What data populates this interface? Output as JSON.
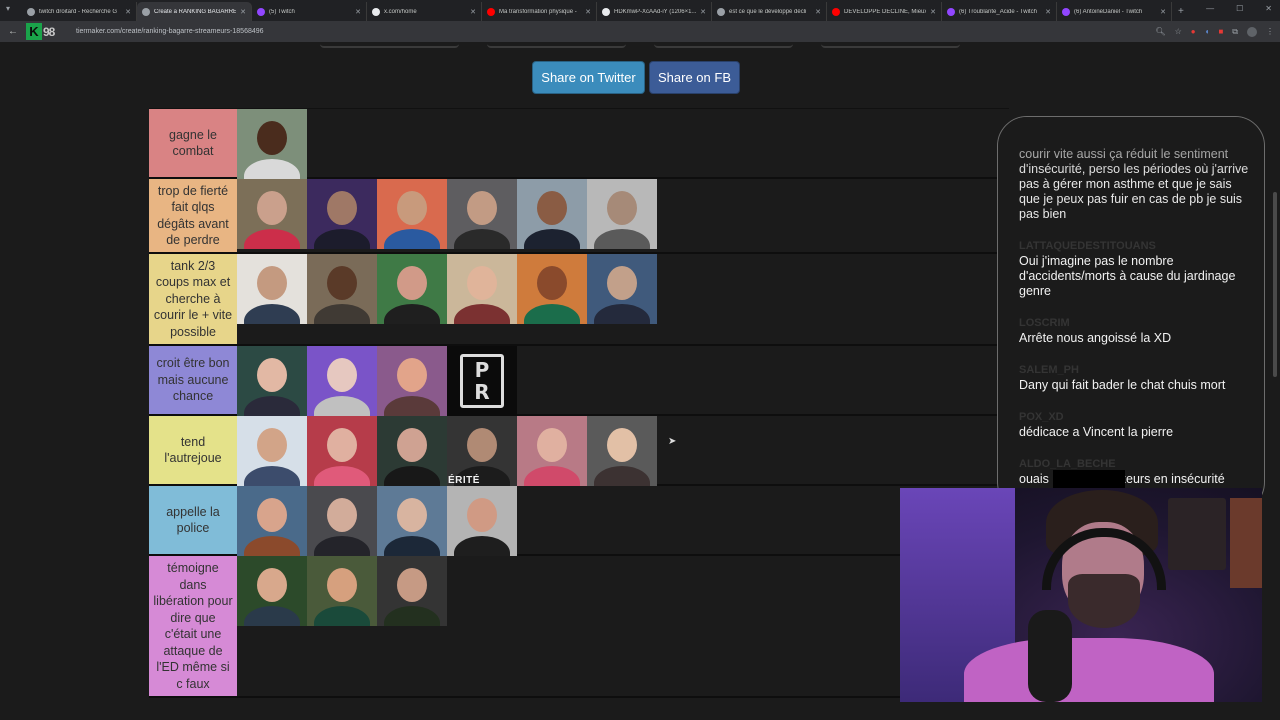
{
  "browser": {
    "tabs": [
      {
        "title": "twitch droitard - Recherche G",
        "color": "#9aa0a6",
        "active": false
      },
      {
        "title": "Create a RANKING BAGARRE",
        "color": "#9aa0a6",
        "active": true
      },
      {
        "title": "(5) Twitch",
        "color": "#9146ff",
        "active": false
      },
      {
        "title": "x.com/home",
        "color": "#e8eaed",
        "active": false
      },
      {
        "title": "Ma transformation physique -",
        "color": "#ff0000",
        "active": false
      },
      {
        "title": "HDKmwP-XcAAd-iY (1206×1...",
        "color": "#e8eaed",
        "active": false
      },
      {
        "title": "est ce que le développé décli",
        "color": "#9aa0a6",
        "active": false
      },
      {
        "title": "DÉVELOPPÉ DÉCLINÉ, Mieux...",
        "color": "#ff0000",
        "active": false
      },
      {
        "title": "(6) Troublante_Acide - Twitch",
        "color": "#9146ff",
        "active": false
      },
      {
        "title": "(6) AntoineDaniel - Twitch",
        "color": "#9146ff",
        "active": false
      }
    ],
    "new_tab_label": "+",
    "url": "tiermaker.com/create/ranking-bagarre-streameurs-18568496"
  },
  "share": {
    "twitter_label": "Share on Twitter",
    "fb_label": "Share on FB"
  },
  "tiers": [
    {
      "label": "gagne le combat",
      "color": "#d98384",
      "height": 70,
      "items": [
        {
          "bg": "#7d8f7a",
          "skin": "#4a2c1d",
          "cloth": "#d9d9d9"
        }
      ]
    },
    {
      "label": "trop de fierté fait qlqs dégâts avant de perdre",
      "color": "#e8b583",
      "height": 75,
      "items": [
        {
          "bg": "#7c6f58",
          "skin": "#caa08c",
          "cloth": "#cc2e4a"
        },
        {
          "bg": "#3c2a5e",
          "skin": "#9f7866",
          "cloth": "#1c1c2c"
        },
        {
          "bg": "#d96a4e",
          "skin": "#c89a7c",
          "cloth": "#2a5aa0"
        },
        {
          "bg": "#5e5d60",
          "skin": "#c29b84",
          "cloth": "#2a2a2a"
        },
        {
          "bg": "#8d9ca8",
          "skin": "#8a5c44",
          "cloth": "#1c2230"
        },
        {
          "bg": "#b8b8b8",
          "skin": "#a68a78",
          "cloth": "#5a5a5a"
        }
      ]
    },
    {
      "label": "tank 2/3 coups max et cherche à courir le + vite possible",
      "color": "#e7d58a",
      "height": 92,
      "items": [
        {
          "bg": "#e4e1dc",
          "skin": "#c49a80",
          "cloth": "#2f3d52"
        },
        {
          "bg": "#7a6b58",
          "skin": "#5a3a28",
          "cloth": "#403a34"
        },
        {
          "bg": "#3f7a46",
          "skin": "#d19a88",
          "cloth": "#1f1f1f"
        },
        {
          "bg": "#cbb79a",
          "skin": "#e0b49a",
          "cloth": "#7b3131"
        },
        {
          "bg": "#cf7b3c",
          "skin": "#8a4a2c",
          "cloth": "#1b6d4b"
        },
        {
          "bg": "#405a7c",
          "skin": "#c2a08a",
          "cloth": "#242a3c"
        }
      ]
    },
    {
      "label": "croit être bon mais aucune chance",
      "color": "#8e88d6",
      "height": 70,
      "items": [
        {
          "bg": "#2c4a44",
          "skin": "#e2b8a4",
          "cloth": "#2a2a3a"
        },
        {
          "bg": "#7a54c8",
          "skin": "#e6c8c0",
          "cloth": "#c0c0c0"
        },
        {
          "bg": "#8a5a8c",
          "skin": "#e2a48a",
          "cloth": "#5a3a3a"
        },
        {
          "pr": true
        }
      ]
    },
    {
      "label": "tend l'autrejoue",
      "color": "#e4e28a",
      "height": 70,
      "items": [
        {
          "bg": "#d6dfe8",
          "skin": "#d2a488",
          "cloth": "#3c4c6c"
        },
        {
          "bg": "#b63c4a",
          "skin": "#e0b0a0",
          "cloth": "#e05a7a"
        },
        {
          "bg": "#2c3a34",
          "skin": "#cfa292",
          "cloth": "#181818"
        },
        {
          "bg": "#343434",
          "skin": "#b08a74",
          "cloth": "#1c1c1c",
          "erite": "ÉRITÉ"
        },
        {
          "bg": "#b87a86",
          "skin": "#e0b0a0",
          "cloth": "#d04a6a"
        },
        {
          "bg": "#5a5a5a",
          "skin": "#e2c0a6",
          "cloth": "#3c3232"
        }
      ]
    },
    {
      "label": "appelle la police",
      "color": "#80bcd8",
      "height": 70,
      "items": [
        {
          "bg": "#4a6a8a",
          "skin": "#d8a48c",
          "cloth": "#8b4a2c"
        },
        {
          "bg": "#4a4a4e",
          "skin": "#d2ac9a",
          "cloth": "#24242a"
        },
        {
          "bg": "#5e7a96",
          "skin": "#d8b4a0",
          "cloth": "#1c2838"
        },
        {
          "bg": "#b4b4b4",
          "skin": "#d09a84",
          "cloth": "#1e1e1e"
        }
      ]
    },
    {
      "label": "témoigne dans libération pour dire que c'était une attaque de l'ED même si c faux",
      "color": "#d68ad6",
      "height": 142,
      "items": [
        {
          "bg": "#2c4a2a",
          "skin": "#d8a88c",
          "cloth": "#2a3a4a"
        },
        {
          "bg": "#4a5a3a",
          "skin": "#d6a07e",
          "cloth": "#1a4a3a"
        },
        {
          "bg": "#343434",
          "skin": "#c69a84",
          "cloth": "#23301f"
        }
      ]
    }
  ],
  "chat": {
    "messages": [
      {
        "user": "",
        "text": "courir vite aussi ça réduit le sentiment d'insécurité, perso les périodes où j'arrive pas à gérer mon asthme et que je sais que je peux pas fuir en cas de pb je suis pas bien"
      },
      {
        "user": "LATTAQUEDESTITOUANS",
        "text": "Oui j'imagine pas le nombre d'accidents/morts à cause du jardinage genre"
      },
      {
        "user": "LOSCRIM",
        "text": "Arrête nous angoissé la XD"
      },
      {
        "user": "SALEM_PH",
        "text": "Dany qui fait bader le chat chuis mort"
      },
      {
        "user": "POX_XD",
        "text": "dédicace a Vincent la pierre"
      },
      {
        "user": "ALDO_LA_BECHE",
        "text": "ouais mais des boxeurs en insécurité dans la rue j'en ai vu pleiiiiin"
      }
    ]
  },
  "colors": {
    "twitter": "#3b8cbc",
    "facebook": "#3c5c97",
    "page_bg": "#1b1b1b"
  }
}
